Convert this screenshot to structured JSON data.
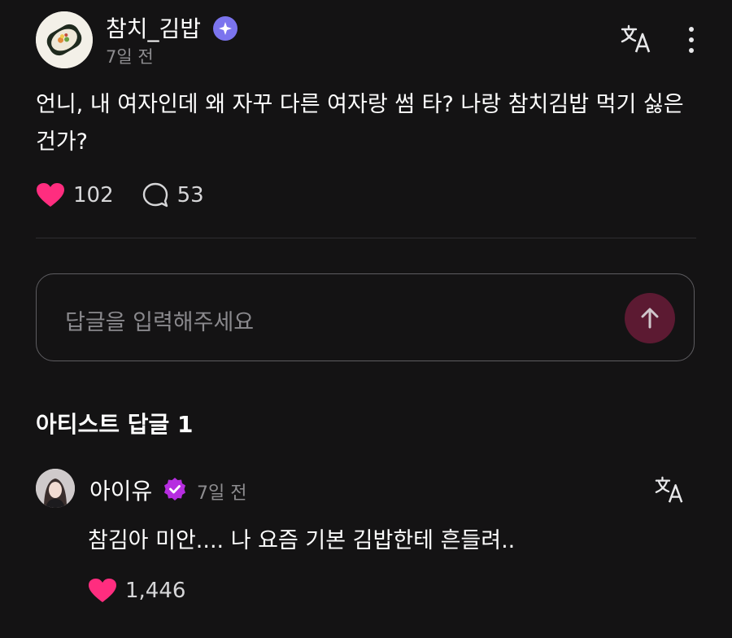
{
  "post": {
    "author": "참치_김밥",
    "time": "7일 전",
    "body": "언니, 내 여자인데 왜 자꾸 다른 여자랑 썸 타? 나랑 참치김밥 먹기 싫은 건가?",
    "likes": "102",
    "comments": "53"
  },
  "reply": {
    "placeholder": "답글을 입력해주세요"
  },
  "artist_replies": {
    "title": "아티스트 답글 1",
    "items": [
      {
        "author": "아이유",
        "time": "7일 전",
        "body": "참김아 미안.... 나 요즘 기본 김밥한테 흔들려..",
        "likes": "1,446"
      }
    ]
  },
  "colors": {
    "background": "#141314",
    "like_heart": "#ff2d7f",
    "verified_blue": "#7b74ee",
    "verified_purple": "#b62de0",
    "send_button": "#5c1a32"
  },
  "icons": [
    "kimbap-avatar",
    "verified-badge-icon",
    "translate-icon",
    "more-vertical-icon",
    "heart-icon",
    "comment-icon",
    "arrow-up-icon",
    "artist-avatar"
  ]
}
